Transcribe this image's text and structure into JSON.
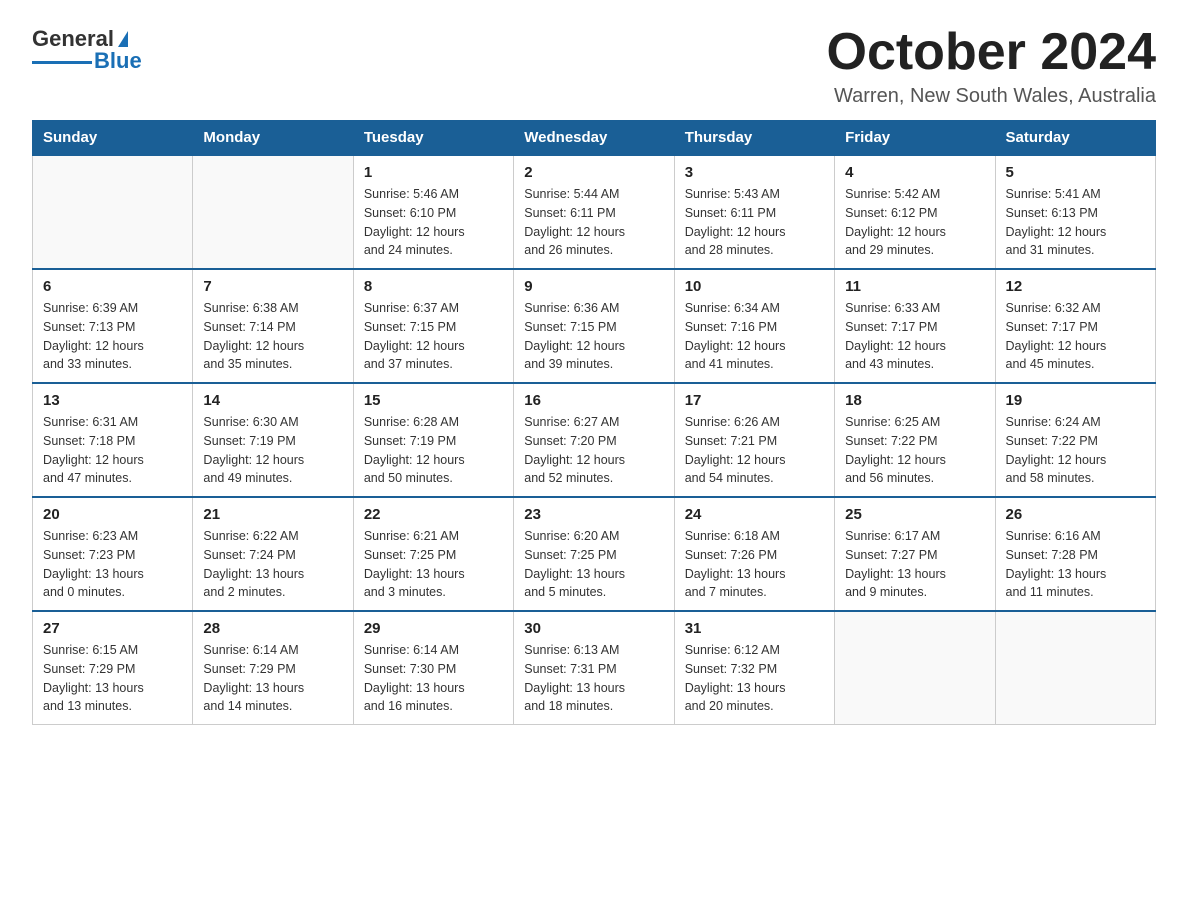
{
  "logo": {
    "text_general": "General",
    "text_blue": "Blue"
  },
  "header": {
    "title": "October 2024",
    "subtitle": "Warren, New South Wales, Australia"
  },
  "weekdays": [
    "Sunday",
    "Monday",
    "Tuesday",
    "Wednesday",
    "Thursday",
    "Friday",
    "Saturday"
  ],
  "weeks": [
    [
      {
        "day": "",
        "info": ""
      },
      {
        "day": "",
        "info": ""
      },
      {
        "day": "1",
        "info": "Sunrise: 5:46 AM\nSunset: 6:10 PM\nDaylight: 12 hours\nand 24 minutes."
      },
      {
        "day": "2",
        "info": "Sunrise: 5:44 AM\nSunset: 6:11 PM\nDaylight: 12 hours\nand 26 minutes."
      },
      {
        "day": "3",
        "info": "Sunrise: 5:43 AM\nSunset: 6:11 PM\nDaylight: 12 hours\nand 28 minutes."
      },
      {
        "day": "4",
        "info": "Sunrise: 5:42 AM\nSunset: 6:12 PM\nDaylight: 12 hours\nand 29 minutes."
      },
      {
        "day": "5",
        "info": "Sunrise: 5:41 AM\nSunset: 6:13 PM\nDaylight: 12 hours\nand 31 minutes."
      }
    ],
    [
      {
        "day": "6",
        "info": "Sunrise: 6:39 AM\nSunset: 7:13 PM\nDaylight: 12 hours\nand 33 minutes."
      },
      {
        "day": "7",
        "info": "Sunrise: 6:38 AM\nSunset: 7:14 PM\nDaylight: 12 hours\nand 35 minutes."
      },
      {
        "day": "8",
        "info": "Sunrise: 6:37 AM\nSunset: 7:15 PM\nDaylight: 12 hours\nand 37 minutes."
      },
      {
        "day": "9",
        "info": "Sunrise: 6:36 AM\nSunset: 7:15 PM\nDaylight: 12 hours\nand 39 minutes."
      },
      {
        "day": "10",
        "info": "Sunrise: 6:34 AM\nSunset: 7:16 PM\nDaylight: 12 hours\nand 41 minutes."
      },
      {
        "day": "11",
        "info": "Sunrise: 6:33 AM\nSunset: 7:17 PM\nDaylight: 12 hours\nand 43 minutes."
      },
      {
        "day": "12",
        "info": "Sunrise: 6:32 AM\nSunset: 7:17 PM\nDaylight: 12 hours\nand 45 minutes."
      }
    ],
    [
      {
        "day": "13",
        "info": "Sunrise: 6:31 AM\nSunset: 7:18 PM\nDaylight: 12 hours\nand 47 minutes."
      },
      {
        "day": "14",
        "info": "Sunrise: 6:30 AM\nSunset: 7:19 PM\nDaylight: 12 hours\nand 49 minutes."
      },
      {
        "day": "15",
        "info": "Sunrise: 6:28 AM\nSunset: 7:19 PM\nDaylight: 12 hours\nand 50 minutes."
      },
      {
        "day": "16",
        "info": "Sunrise: 6:27 AM\nSunset: 7:20 PM\nDaylight: 12 hours\nand 52 minutes."
      },
      {
        "day": "17",
        "info": "Sunrise: 6:26 AM\nSunset: 7:21 PM\nDaylight: 12 hours\nand 54 minutes."
      },
      {
        "day": "18",
        "info": "Sunrise: 6:25 AM\nSunset: 7:22 PM\nDaylight: 12 hours\nand 56 minutes."
      },
      {
        "day": "19",
        "info": "Sunrise: 6:24 AM\nSunset: 7:22 PM\nDaylight: 12 hours\nand 58 minutes."
      }
    ],
    [
      {
        "day": "20",
        "info": "Sunrise: 6:23 AM\nSunset: 7:23 PM\nDaylight: 13 hours\nand 0 minutes."
      },
      {
        "day": "21",
        "info": "Sunrise: 6:22 AM\nSunset: 7:24 PM\nDaylight: 13 hours\nand 2 minutes."
      },
      {
        "day": "22",
        "info": "Sunrise: 6:21 AM\nSunset: 7:25 PM\nDaylight: 13 hours\nand 3 minutes."
      },
      {
        "day": "23",
        "info": "Sunrise: 6:20 AM\nSunset: 7:25 PM\nDaylight: 13 hours\nand 5 minutes."
      },
      {
        "day": "24",
        "info": "Sunrise: 6:18 AM\nSunset: 7:26 PM\nDaylight: 13 hours\nand 7 minutes."
      },
      {
        "day": "25",
        "info": "Sunrise: 6:17 AM\nSunset: 7:27 PM\nDaylight: 13 hours\nand 9 minutes."
      },
      {
        "day": "26",
        "info": "Sunrise: 6:16 AM\nSunset: 7:28 PM\nDaylight: 13 hours\nand 11 minutes."
      }
    ],
    [
      {
        "day": "27",
        "info": "Sunrise: 6:15 AM\nSunset: 7:29 PM\nDaylight: 13 hours\nand 13 minutes."
      },
      {
        "day": "28",
        "info": "Sunrise: 6:14 AM\nSunset: 7:29 PM\nDaylight: 13 hours\nand 14 minutes."
      },
      {
        "day": "29",
        "info": "Sunrise: 6:14 AM\nSunset: 7:30 PM\nDaylight: 13 hours\nand 16 minutes."
      },
      {
        "day": "30",
        "info": "Sunrise: 6:13 AM\nSunset: 7:31 PM\nDaylight: 13 hours\nand 18 minutes."
      },
      {
        "day": "31",
        "info": "Sunrise: 6:12 AM\nSunset: 7:32 PM\nDaylight: 13 hours\nand 20 minutes."
      },
      {
        "day": "",
        "info": ""
      },
      {
        "day": "",
        "info": ""
      }
    ]
  ]
}
